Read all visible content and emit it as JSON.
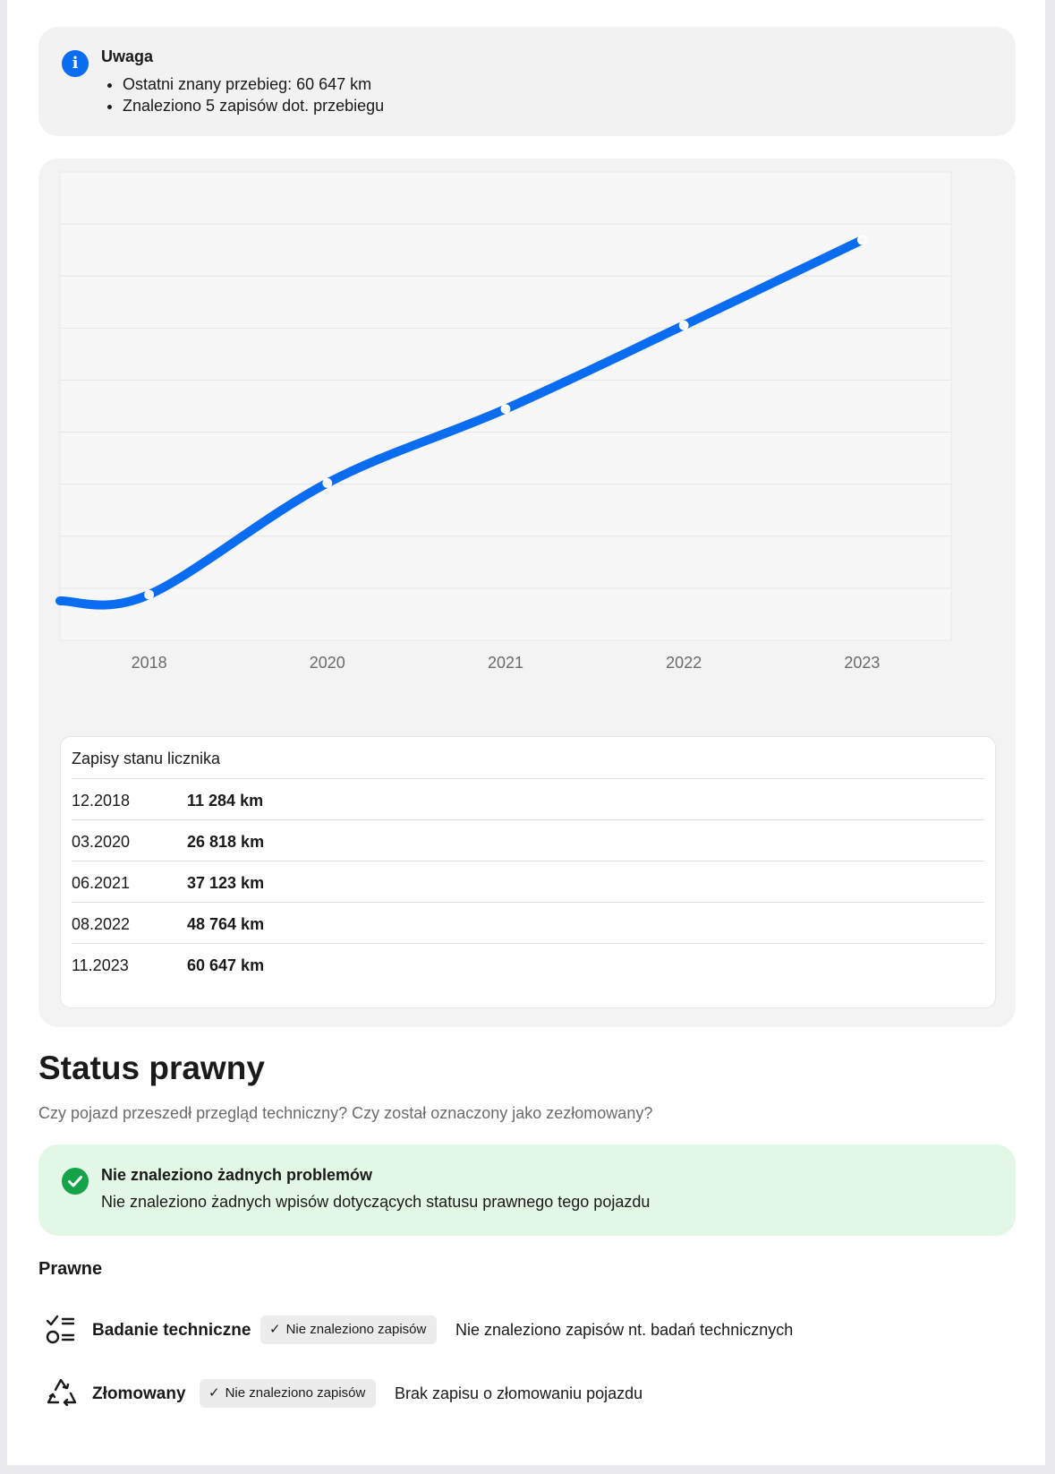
{
  "notice": {
    "title": "Uwaga",
    "items": [
      "Ostatni znany przebieg: 60 647 km",
      "Znaleziono 5 zapisów dot. przebiegu"
    ],
    "icon": "info-icon",
    "accent": "#0a6cf0"
  },
  "chart_data": {
    "type": "line",
    "categories": [
      "2018",
      "2020",
      "2021",
      "2022",
      "2023"
    ],
    "series": [
      {
        "values": [
          11284,
          26818,
          37123,
          48764,
          60647
        ]
      }
    ],
    "line_color": "#0a6cf0",
    "grid": true,
    "legend": "none"
  },
  "records": {
    "title": "Zapisy stanu licznika",
    "rows": [
      {
        "date": "12.2018",
        "value": "11 284 km"
      },
      {
        "date": "03.2020",
        "value": "26 818 km"
      },
      {
        "date": "06.2021",
        "value": "37 123 km"
      },
      {
        "date": "08.2022",
        "value": "48 764 km"
      },
      {
        "date": "11.2023",
        "value": "60 647 km"
      }
    ]
  },
  "status": {
    "title": "Status prawny",
    "subtitle": "Czy pojazd przeszedł przegląd techniczny? Czy został oznaczony jako zezłomowany?"
  },
  "ok_box": {
    "title": "Nie znaleziono żadnych problemów",
    "description": "Nie znaleziono żadnych wpisów dotyczących statusu prawnego tego pojazdu",
    "icon": "check-circle-icon",
    "color": "#15a34a",
    "background": "#e3f7e6"
  },
  "legal": {
    "heading": "Prawne",
    "items": [
      {
        "icon": "checklist-icon",
        "label": "Badanie techniczne",
        "badge": "Nie znaleziono zapisów",
        "description": "Nie znaleziono zapisów nt. badań technicznych"
      },
      {
        "icon": "recycle-icon",
        "label": "Złomowany",
        "badge": "Nie znaleziono zapisów",
        "description": "Brak zapisu o złomowaniu pojazdu"
      }
    ]
  }
}
